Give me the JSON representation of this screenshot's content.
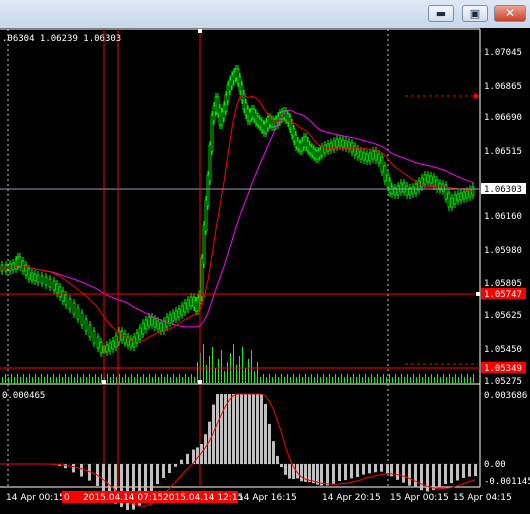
{
  "window": {
    "minimize_icon": "minimize-icon",
    "maximize_icon": "maximize-icon",
    "close_icon": "close-icon"
  },
  "header": {
    "ohlc_text": ".06304 1.06239 1.06303"
  },
  "price_axis": {
    "labels": [
      "1.07045",
      "1.06865",
      "1.06690",
      "1.06515",
      "1.06303",
      "1.06160",
      "1.05980",
      "1.05805",
      "1.05747",
      "1.05625",
      "1.05450",
      "1.05349",
      "1.05275"
    ],
    "current_price": "1.06303",
    "hline_upper_price": "1.05747",
    "hline_lower_price": "1.05349"
  },
  "indicator_axis": {
    "top_label": "0.003686",
    "zero_label": "0.00",
    "bottom_label": "-0.001145",
    "window_value": "0.000465"
  },
  "time_axis": {
    "labels": [
      "14 Apr 00:15",
      "14 Apr 16:15",
      "14 Apr 20:15",
      "15 Apr 00:15",
      "15 Apr 04:15"
    ],
    "highlight_labels": [
      "2015.04.14 07:15",
      "2015.04.14 12:15"
    ],
    "highlight_prefix": "0"
  },
  "colors": {
    "background": "#000000",
    "bull": "#00ff00",
    "ma_fast": "#ff0000",
    "ma_slow": "#ff00ff",
    "hline": "#ff0000",
    "current_price_line": "#a0a0c0",
    "histogram": "#c0c0c0"
  },
  "chart_data": {
    "type": "candlestick",
    "x_range": [
      "2015.04.13 23:00",
      "2015.04.15 04:45"
    ],
    "y_range": [
      1.05275,
      1.0712
    ],
    "indicator_range": [
      -0.001145,
      0.003686
    ]
  }
}
